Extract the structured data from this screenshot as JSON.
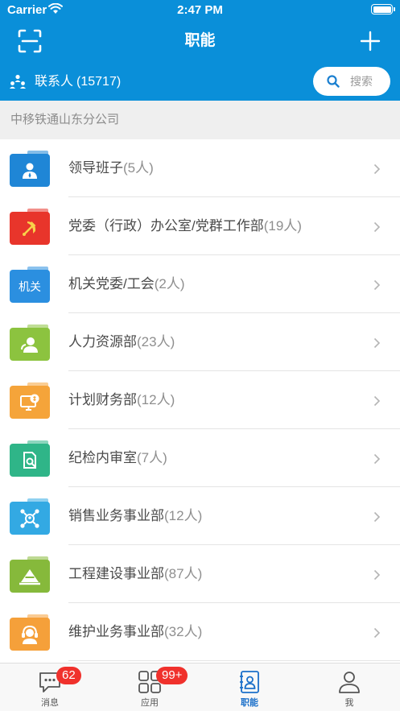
{
  "status_bar": {
    "carrier": "Carrier",
    "time": "2:47 PM"
  },
  "header": {
    "title": "职能",
    "scan_icon": "scan-icon",
    "add_icon": "plus-icon"
  },
  "contacts": {
    "label": "联系人",
    "count": "(15717)",
    "icon": "org-chart-icon"
  },
  "search": {
    "placeholder": "搜索",
    "icon": "search-icon"
  },
  "company": {
    "name": "中移铁通山东分公司"
  },
  "departments": [
    {
      "name": "领导班子",
      "count": "(5人)",
      "color": "#1f86d6",
      "icon": "person-icon"
    },
    {
      "name": "党委（行政）办公室/党群工作部",
      "count": "(19人)",
      "color": "#e8352b",
      "icon": "hammer-sickle-icon"
    },
    {
      "name": "机关党委/工会",
      "count": "(2人)",
      "color": "#2b8fe0",
      "icon_text": "机关"
    },
    {
      "name": "人力资源部",
      "count": "(23人)",
      "color": "#8cc33f",
      "icon": "people-icon"
    },
    {
      "name": "计划财务部",
      "count": "(12人)",
      "color": "#f5a43a",
      "icon": "finance-monitor-icon"
    },
    {
      "name": "纪检内审室",
      "count": "(7人)",
      "color": "#2fb588",
      "icon": "audit-document-icon"
    },
    {
      "name": "销售业务事业部",
      "count": "(12人)",
      "color": "#33a9e3",
      "icon": "network-hub-icon"
    },
    {
      "name": "工程建设事业部",
      "count": "(87人)",
      "color": "#86b93b",
      "icon": "construction-icon"
    },
    {
      "name": "维护业务事业部",
      "count": "(32人)",
      "color": "#f5a03a",
      "icon": "headset-icon"
    }
  ],
  "tabbar": [
    {
      "label": "消息",
      "badge": "62",
      "icon": "message-icon"
    },
    {
      "label": "应用",
      "badge": "99+",
      "icon": "apps-grid-icon"
    },
    {
      "label": "职能",
      "badge": "",
      "icon": "address-book-icon",
      "active": true
    },
    {
      "label": "我",
      "badge": "",
      "icon": "profile-icon"
    }
  ],
  "colors": {
    "header": "#0a8fd9",
    "active_tab": "#1a6fc9",
    "badge": "#f0312c"
  }
}
